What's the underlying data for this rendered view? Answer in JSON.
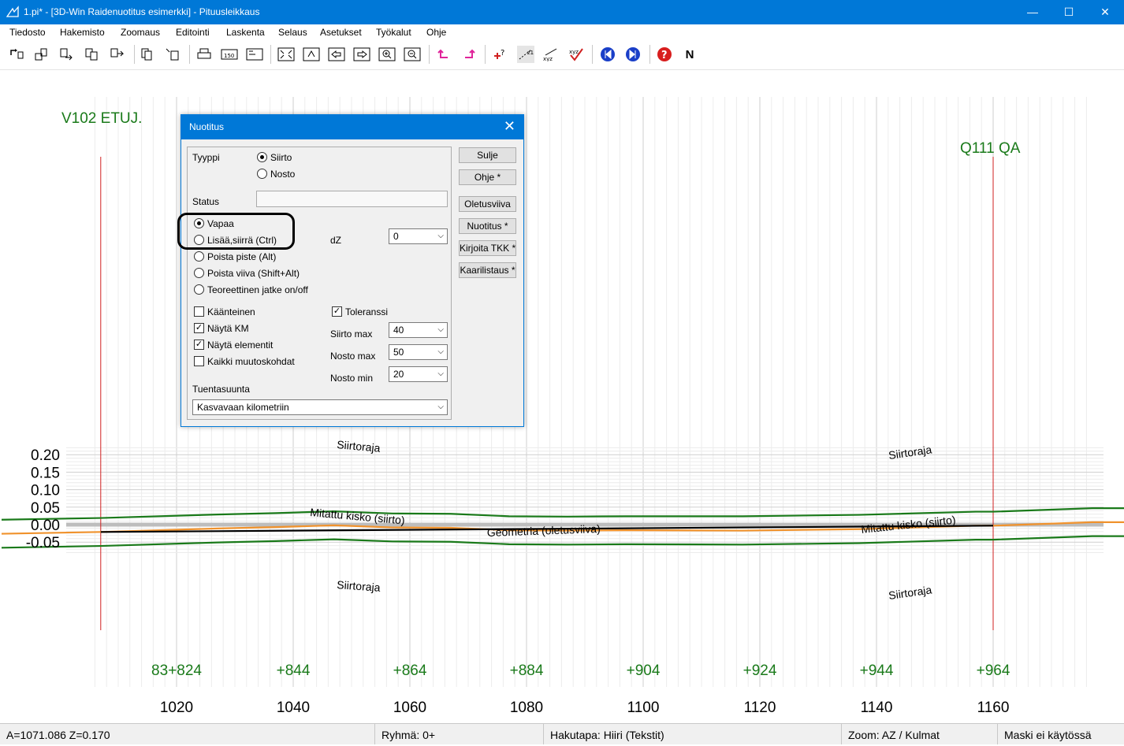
{
  "window": {
    "title": "1.pi* - [3D-Win Raidenuotitus esimerkki] - Pituusleikkaus",
    "minimize": "—",
    "maximize": "☐",
    "close": "✕"
  },
  "menu": [
    "Tiedosto",
    "Hakemisto",
    "Zoomaus",
    "Editointi",
    "Laskenta",
    "Selaus",
    "Asetukset",
    "Työkalut",
    "Ohje"
  ],
  "toolbar": {
    "n_label": "N",
    "icons": [
      "open-icon",
      "save-icon",
      "save-as-icon",
      "copy-file-icon",
      "export-icon",
      "copy-icon",
      "paste-icon",
      "print-icon",
      "scale-icon",
      "fit-icon",
      "zoom-all-icon",
      "pan-icon",
      "previous-icon",
      "next-icon",
      "zoom-in-icon",
      "zoom-out-icon",
      "undo-icon",
      "redo-icon",
      "add-point-icon",
      "point-tool-icon",
      "xyz-icon",
      "check-icon",
      "rewind-icon",
      "forward-icon",
      "help-icon"
    ]
  },
  "plot": {
    "left_label": "V102 ETUJ.",
    "right_label": "Q111 QA",
    "y_ticks": [
      "0.20",
      "0.15",
      "0.10",
      "0.05",
      "0.00",
      "-0.05"
    ],
    "x_ticks": [
      "1020",
      "1040",
      "1060",
      "1080",
      "1100",
      "1120",
      "1140",
      "1160"
    ],
    "km_labels": [
      "83+824",
      "+844",
      "+864",
      "+884",
      "+904",
      "+924",
      "+944",
      "+964"
    ],
    "curve_labels": {
      "siirtoraja_top_left": "Siirtoraja",
      "siirtoraja_top_right": "Siirtoraja",
      "siirtoraja_bottom_left": "Siirtoraja",
      "siirtoraja_bottom_right": "Siirtoraja",
      "measured_left": "Mitattu kisko (siirto)",
      "measured_right": "Mitattu kisko (siirto)",
      "geometry": "Geometria (oletusviiva)"
    },
    "colors": {
      "limit": "#1a7a1a",
      "measured": "#f0922c",
      "geometry": "#000000",
      "marker": "#d02020",
      "zero": "#bdbdbd",
      "label_green": "#1a7a1a"
    }
  },
  "chart_data": {
    "type": "line",
    "xlabel": "",
    "ylabel": "",
    "xlim": [
      1006,
      1176
    ],
    "ylim": [
      -0.085,
      0.23
    ],
    "markers_x": [
      1007,
      1160
    ],
    "series": [
      {
        "x": [
          990,
          1007,
          1027,
          1037,
          1047,
          1057,
          1067,
          1077,
          1087,
          1097,
          1117,
          1137,
          1157,
          1160,
          1177,
          1190
        ],
        "values": [
          0.014,
          0.019,
          0.029,
          0.033,
          0.038,
          0.032,
          0.031,
          0.024,
          0.023,
          0.024,
          0.024,
          0.028,
          0.037,
          0.037,
          0.047,
          0.047
        ]
      },
      {
        "x": [
          990,
          1007,
          1027,
          1037,
          1047,
          1057,
          1067,
          1077,
          1087,
          1097,
          1117,
          1137,
          1157,
          1160,
          1177,
          1190
        ],
        "values": [
          -0.066,
          -0.061,
          -0.051,
          -0.047,
          -0.042,
          -0.048,
          -0.049,
          -0.056,
          -0.057,
          -0.056,
          -0.057,
          -0.053,
          -0.043,
          -0.043,
          -0.033,
          -0.033
        ]
      },
      {
        "x": [
          990,
          1007,
          1027,
          1037,
          1047,
          1057,
          1067,
          1077,
          1087,
          1097,
          1117,
          1137,
          1157,
          1160,
          1177,
          1190
        ],
        "values": [
          -0.026,
          -0.021,
          -0.011,
          -0.007,
          -0.002,
          -0.008,
          -0.009,
          -0.016,
          -0.017,
          -0.016,
          -0.017,
          -0.013,
          -0.003,
          -0.003,
          0.007,
          0.007
        ]
      },
      {
        "x": [
          1007,
          1160
        ],
        "values": [
          -0.021,
          -0.003
        ]
      }
    ]
  },
  "dialog": {
    "title": "Nuotitus",
    "close": "✕",
    "tyyppi_label": "Tyyppi",
    "tyyppi_siirto": "Siirto",
    "tyyppi_nosto": "Nosto",
    "status_label": "Status",
    "status_value": "",
    "modes": [
      "Vapaa",
      "Lisää,siirrä  (Ctrl)",
      "Poista piste  (Alt)",
      "Poista viiva  (Shift+Alt)",
      "Teoreettinen jatke on/off"
    ],
    "dz_label": "dZ",
    "dz_value": "0",
    "kaanteinen": "Käänteinen",
    "nayta_km": "Näytä KM",
    "nayta_elementit": "Näytä elementit",
    "kaikki_muutoskohdat": "Kaikki muutoskohdat",
    "toleranssi": "Toleranssi",
    "siirto_max_label": "Siirto max",
    "siirto_max_value": "40",
    "nosto_max_label": "Nosto max",
    "nosto_max_value": "50",
    "nosto_min_label": "Nosto min",
    "nosto_min_value": "20",
    "tuentasuunta_label": "Tuentasuunta",
    "tuentasuunta_value": "Kasvavaan kilometriin",
    "check_mark": "✓",
    "combo_arrow": "⌵",
    "buttons": [
      "Sulje",
      "Ohje *",
      "Oletusviiva",
      "Nuotitus *",
      "Kirjoita TKK *",
      "Kaarilistaus *"
    ]
  },
  "status": {
    "coords": "A=1071.086  Z=0.170",
    "ryhma": "Ryhmä: 0+",
    "hakutapa": "Hakutapa: Hiiri (Tekstit)",
    "zoom": "Zoom: AZ  /  Kulmat",
    "maski": "Maski ei käytössä"
  }
}
